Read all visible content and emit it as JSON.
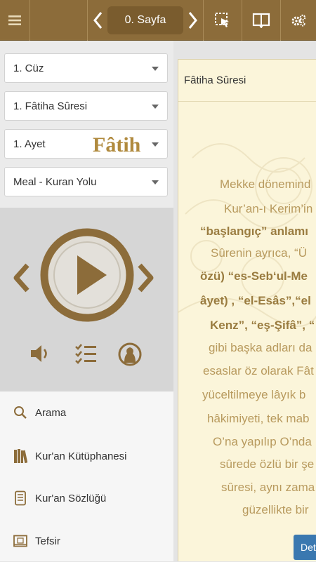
{
  "topbar": {
    "menu_icon": "hamburger-icon",
    "prev_icon": "chevron-left-icon",
    "page_label": "0. Sayfa",
    "next_icon": "chevron-right-icon",
    "select_icon": "selection-cursor-icon",
    "book_icon": "open-book-icon",
    "settings_icon": "gears-icon",
    "color": "#8c6c3a"
  },
  "selectors": {
    "cuz": "1. Cüz",
    "sure": "1. Fâtiha Sûresi",
    "ayet": "1. Ayet",
    "meal": "Meal - Kuran Yolu"
  },
  "player": {
    "prev_icon": "chevron-left-icon",
    "play_icon": "play-icon",
    "next_icon": "chevron-right-icon",
    "volume_icon": "speaker-icon",
    "list_icon": "checklist-icon",
    "reciter_icon": "reciter-avatar-icon",
    "accent": "#8c6c3a"
  },
  "menu": {
    "items": [
      {
        "label": "Arama",
        "icon": "search-icon"
      },
      {
        "label": "Kur'an Kütüphanesi",
        "icon": "library-icon"
      },
      {
        "label": "Kur'an Sözlüğü",
        "icon": "dictionary-icon"
      },
      {
        "label": "Tefsir",
        "icon": "tefsir-icon"
      }
    ]
  },
  "content": {
    "header": "Fâtiha Sûresi",
    "title": "Fâtih",
    "lines": [
      "Mekke dönemind",
      "Kur’an-ı Kerim’in",
      "“başlangıç” anlamı",
      "Sûrenin ayrıca, “Ü",
      "özü) “es-Seb‘ul-Me",
      "âyet) , “el-Esâs”,“el",
      "Kenz”, “eş-Şifâ”, “",
      "gibi başka adları da",
      "esaslar öz olarak Fât",
      "yüceltilmeye lâyık b",
      "hâkimiyeti, tek mab",
      "O’na yapılıp O’nda",
      "sûrede özlü bir şe",
      "sûresi, aynı zama",
      "güzellikte bir"
    ],
    "details_button": "Det"
  }
}
